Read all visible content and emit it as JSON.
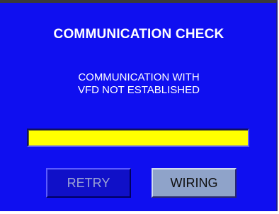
{
  "dialog": {
    "title": "COMMUNICATION CHECK",
    "message_line1": "COMMUNICATION WITH",
    "message_line2": "VFD NOT ESTABLISHED",
    "status_bar_color": "#ffff00",
    "background_color": "#0f0ff0"
  },
  "buttons": {
    "retry_label": "RETRY",
    "wiring_label": "WIRING"
  }
}
